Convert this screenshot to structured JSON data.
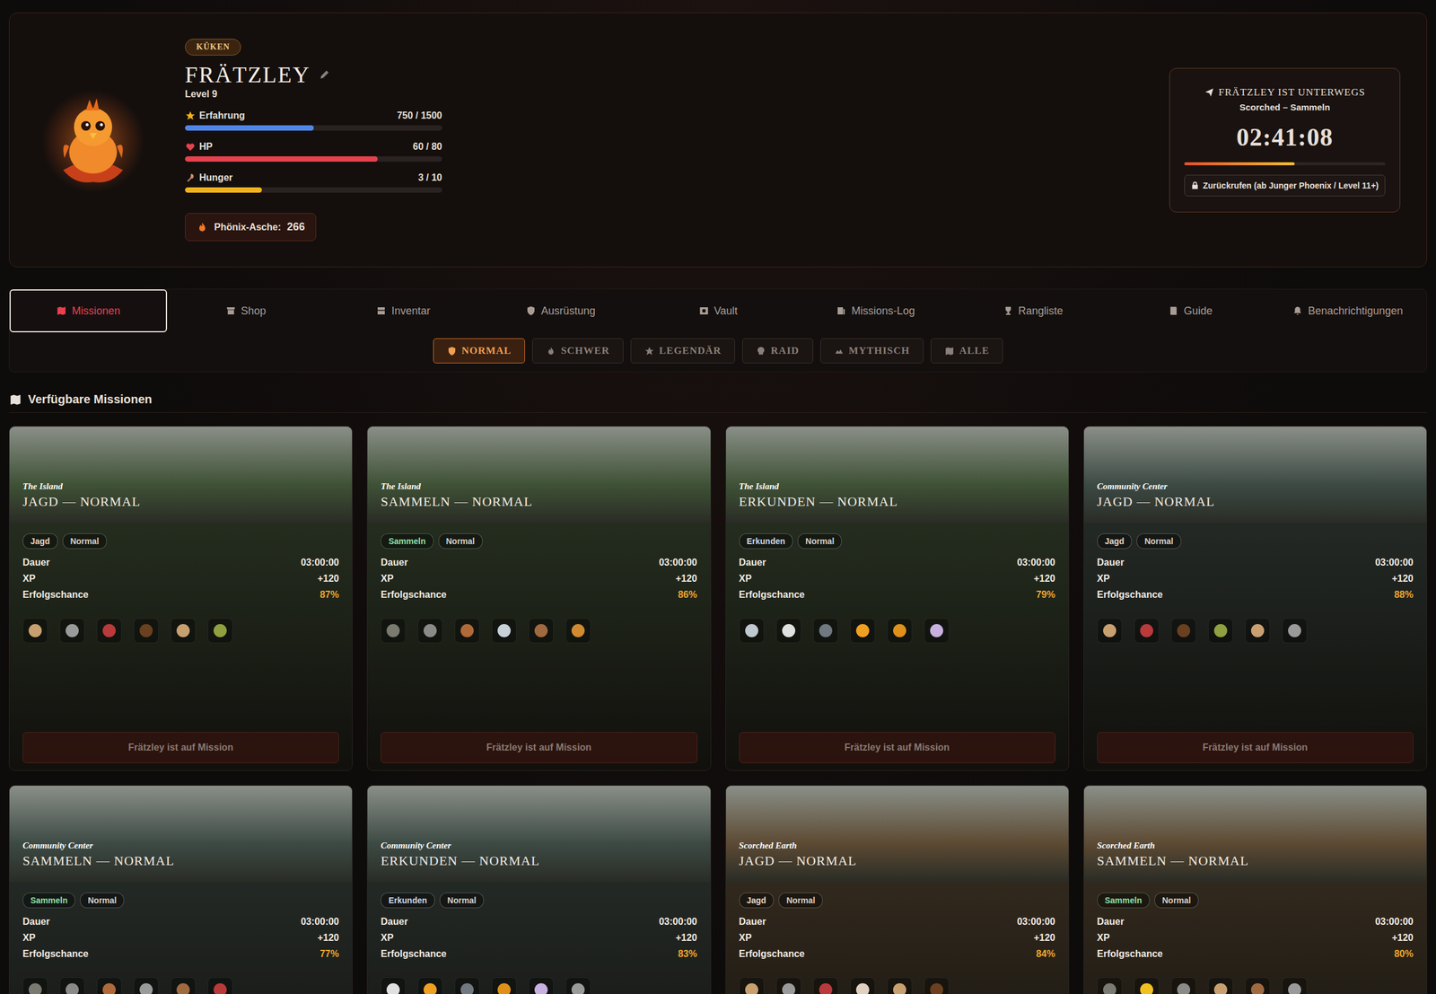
{
  "player": {
    "rank": "KÜKEN",
    "name": "FRÄTZLEY",
    "level": "Level 9",
    "stats": [
      {
        "label": "Erfahrung",
        "value": "750 / 1500",
        "level": 0.5,
        "color": "#4f86e8"
      },
      {
        "label": "HP",
        "value": "60 / 80",
        "level": 0.75,
        "color": "#e5414f"
      },
      {
        "label": "Hunger",
        "value": "3 / 10",
        "level": 0.3,
        "color": "#f1b21c"
      }
    ],
    "currency": {
      "label": "Phönix-Asche:",
      "value": "266"
    }
  },
  "mission_status": {
    "title": "FRÄTZLEY IST UNTERWEGS",
    "subtitle": "Scorched – Sammeln",
    "timer": "02:41:08",
    "level": 0.55,
    "recall": {
      "label": "Zurückrufen (ab Junger Phoenix / Level 11+)",
      "disabled": true
    }
  },
  "tabs": [
    {
      "label": "Missionen",
      "selected": true
    },
    {
      "label": "Shop",
      "selected": false
    },
    {
      "label": "Inventar",
      "selected": false
    },
    {
      "label": "Ausrüstung",
      "selected": false
    },
    {
      "label": "Vault",
      "selected": false
    },
    {
      "label": "Missions-Log",
      "selected": false
    },
    {
      "label": "Rangliste",
      "selected": false
    },
    {
      "label": "Guide",
      "selected": false
    },
    {
      "label": "Benachrichtigungen",
      "selected": false
    }
  ],
  "filters": [
    {
      "label": "NORMAL",
      "selected": true
    },
    {
      "label": "SCHWER",
      "selected": false
    },
    {
      "label": "LEGENDÄR",
      "selected": false
    },
    {
      "label": "RAID",
      "selected": false
    },
    {
      "label": "MYTHISCH",
      "selected": false
    },
    {
      "label": "ALLE",
      "selected": false
    }
  ],
  "section_title": "Verfügbare Missionen",
  "missions": [
    {
      "location": "The Island",
      "title": "JAGD — NORMAL",
      "color": "#3f5236",
      "tags": [
        {
          "label": "Jagd",
          "color": "#e8d8c8"
        },
        {
          "label": "Normal",
          "color": "#d8d0c8"
        }
      ],
      "stats": [
        {
          "label": "Dauer",
          "value": "03:00:00",
          "kind": "plain"
        },
        {
          "label": "XP",
          "value": "+120",
          "kind": "plain"
        },
        {
          "label": "Erfolgschance",
          "value": "87%",
          "kind": "chance"
        }
      ],
      "loot": [
        {
          "color": "#c8a070"
        },
        {
          "color": "#9a9a9a"
        },
        {
          "color": "#b83a3a"
        },
        {
          "color": "#6a4020"
        },
        {
          "color": "#c8a070"
        },
        {
          "color": "#90a040"
        }
      ],
      "button": {
        "label": "Frätzley ist auf Mission",
        "disabled": true
      }
    },
    {
      "location": "The Island",
      "title": "SAMMELN — NORMAL",
      "color": "#3f5236",
      "tags": [
        {
          "label": "Sammeln",
          "color": "#8fe0a8"
        },
        {
          "label": "Normal",
          "color": "#d8d0c8"
        }
      ],
      "stats": [
        {
          "label": "Dauer",
          "value": "03:00:00",
          "kind": "plain"
        },
        {
          "label": "XP",
          "value": "+120",
          "kind": "plain"
        },
        {
          "label": "Erfolgschance",
          "value": "86%",
          "kind": "chance"
        }
      ],
      "loot": [
        {
          "color": "#7a7a70"
        },
        {
          "color": "#8a8a88"
        },
        {
          "color": "#b06a3a"
        },
        {
          "color": "#c8d0d8"
        },
        {
          "color": "#a06a40"
        },
        {
          "color": "#d08a30"
        }
      ],
      "button": {
        "label": "Frätzley ist auf Mission",
        "disabled": true
      }
    },
    {
      "location": "The Island",
      "title": "ERKUNDEN — NORMAL",
      "color": "#3f5236",
      "tags": [
        {
          "label": "Erkunden",
          "color": "#d0d8e8"
        },
        {
          "label": "Normal",
          "color": "#d8d0c8"
        }
      ],
      "stats": [
        {
          "label": "Dauer",
          "value": "03:00:00",
          "kind": "plain"
        },
        {
          "label": "XP",
          "value": "+120",
          "kind": "plain"
        },
        {
          "label": "Erfolgschance",
          "value": "79%",
          "kind": "chance"
        }
      ],
      "loot": [
        {
          "color": "#c0c8d0"
        },
        {
          "color": "#e0e0e0"
        },
        {
          "color": "#707880"
        },
        {
          "color": "#f0a020"
        },
        {
          "color": "#e0901a"
        },
        {
          "color": "#c8b0e0"
        }
      ],
      "button": {
        "label": "Frätzley ist auf Mission",
        "disabled": true
      }
    },
    {
      "location": "Community Center",
      "title": "JAGD — NORMAL",
      "color": "#3d4a44",
      "tags": [
        {
          "label": "Jagd",
          "color": "#e8d8c8"
        },
        {
          "label": "Normal",
          "color": "#d8d0c8"
        }
      ],
      "stats": [
        {
          "label": "Dauer",
          "value": "03:00:00",
          "kind": "plain"
        },
        {
          "label": "XP",
          "value": "+120",
          "kind": "plain"
        },
        {
          "label": "Erfolgschance",
          "value": "88%",
          "kind": "chance"
        }
      ],
      "loot": [
        {
          "color": "#c8a070"
        },
        {
          "color": "#b83a3a"
        },
        {
          "color": "#6a4020"
        },
        {
          "color": "#90a040"
        },
        {
          "color": "#c8a070"
        },
        {
          "color": "#9a9a9a"
        }
      ],
      "button": {
        "label": "Frätzley ist auf Mission",
        "disabled": true
      }
    },
    {
      "location": "Community Center",
      "title": "SAMMELN — NORMAL",
      "color": "#3d4a44",
      "tags": [
        {
          "label": "Sammeln",
          "color": "#8fe0a8"
        },
        {
          "label": "Normal",
          "color": "#d8d0c8"
        }
      ],
      "stats": [
        {
          "label": "Dauer",
          "value": "03:00:00",
          "kind": "plain"
        },
        {
          "label": "XP",
          "value": "+120",
          "kind": "plain"
        },
        {
          "label": "Erfolgschance",
          "value": "77%",
          "kind": "chance"
        }
      ],
      "loot": [
        {
          "color": "#7a7a70"
        },
        {
          "color": "#8a8a88"
        },
        {
          "color": "#b06a3a"
        },
        {
          "color": "#9a9a9a"
        },
        {
          "color": "#a06a40"
        },
        {
          "color": "#b83a3a"
        }
      ]
    },
    {
      "location": "Community Center",
      "title": "ERKUNDEN — NORMAL",
      "color": "#3d4a44",
      "tags": [
        {
          "label": "Erkunden",
          "color": "#d0d8e8"
        },
        {
          "label": "Normal",
          "color": "#d8d0c8"
        }
      ],
      "stats": [
        {
          "label": "Dauer",
          "value": "03:00:00",
          "kind": "plain"
        },
        {
          "label": "XP",
          "value": "+120",
          "kind": "plain"
        },
        {
          "label": "Erfolgschance",
          "value": "83%",
          "kind": "chance"
        }
      ],
      "loot": [
        {
          "color": "#e0e0e0"
        },
        {
          "color": "#f0a020"
        },
        {
          "color": "#707880"
        },
        {
          "color": "#e0901a"
        },
        {
          "color": "#c8b0e0"
        },
        {
          "color": "#9a9a9a"
        }
      ]
    },
    {
      "location": "Scorched Earth",
      "title": "JAGD — NORMAL",
      "color": "#5c4a33",
      "tags": [
        {
          "label": "Jagd",
          "color": "#e8d8c8"
        },
        {
          "label": "Normal",
          "color": "#d8d0c8"
        }
      ],
      "stats": [
        {
          "label": "Dauer",
          "value": "03:00:00",
          "kind": "plain"
        },
        {
          "label": "XP",
          "value": "+120",
          "kind": "plain"
        },
        {
          "label": "Erfolgschance",
          "value": "84%",
          "kind": "chance"
        }
      ],
      "loot": [
        {
          "color": "#c8a070"
        },
        {
          "color": "#9a9a9a"
        },
        {
          "color": "#b83a3a"
        },
        {
          "color": "#e0d0c0"
        },
        {
          "color": "#c8a070"
        },
        {
          "color": "#6a4020"
        }
      ]
    },
    {
      "location": "Scorched Earth",
      "title": "SAMMELN — NORMAL",
      "color": "#5c4a33",
      "tags": [
        {
          "label": "Sammeln",
          "color": "#8fe0a8"
        },
        {
          "label": "Normal",
          "color": "#d8d0c8"
        }
      ],
      "stats": [
        {
          "label": "Dauer",
          "value": "03:00:00",
          "kind": "plain"
        },
        {
          "label": "XP",
          "value": "+120",
          "kind": "plain"
        },
        {
          "label": "Erfolgschance",
          "value": "80%",
          "kind": "chance"
        }
      ],
      "loot": [
        {
          "color": "#7a7a70"
        },
        {
          "color": "#f0c020"
        },
        {
          "color": "#8a8a88"
        },
        {
          "color": "#c8a070"
        },
        {
          "color": "#a06a40"
        },
        {
          "color": "#9a9a9a"
        }
      ]
    }
  ]
}
